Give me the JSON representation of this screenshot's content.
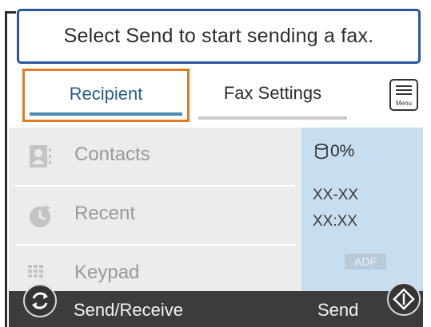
{
  "banner": {
    "message": "Select Send to start sending a fax."
  },
  "tabs": {
    "recipient": "Recipient",
    "fax_settings": "Fax Settings"
  },
  "menu": {
    "label": "Menu"
  },
  "recipient_options": [
    {
      "label": "Contacts",
      "icon": "contacts-icon"
    },
    {
      "label": "Recent",
      "icon": "recent-icon"
    },
    {
      "label": "Keypad",
      "icon": "keypad-icon"
    }
  ],
  "status": {
    "storage": "0%",
    "date": "XX-XX",
    "time": "XX:XX",
    "adf": "ADF"
  },
  "bottom_bar": {
    "send_receive": "Send/Receive",
    "send": "Send"
  },
  "colors": {
    "banner_border": "#2a55a2",
    "selected_tab_outline": "#e07b1f",
    "active_tab_text": "#2c5d8e",
    "status_panel": "#c7def0",
    "bottom_bar": "#3c3c3c"
  }
}
